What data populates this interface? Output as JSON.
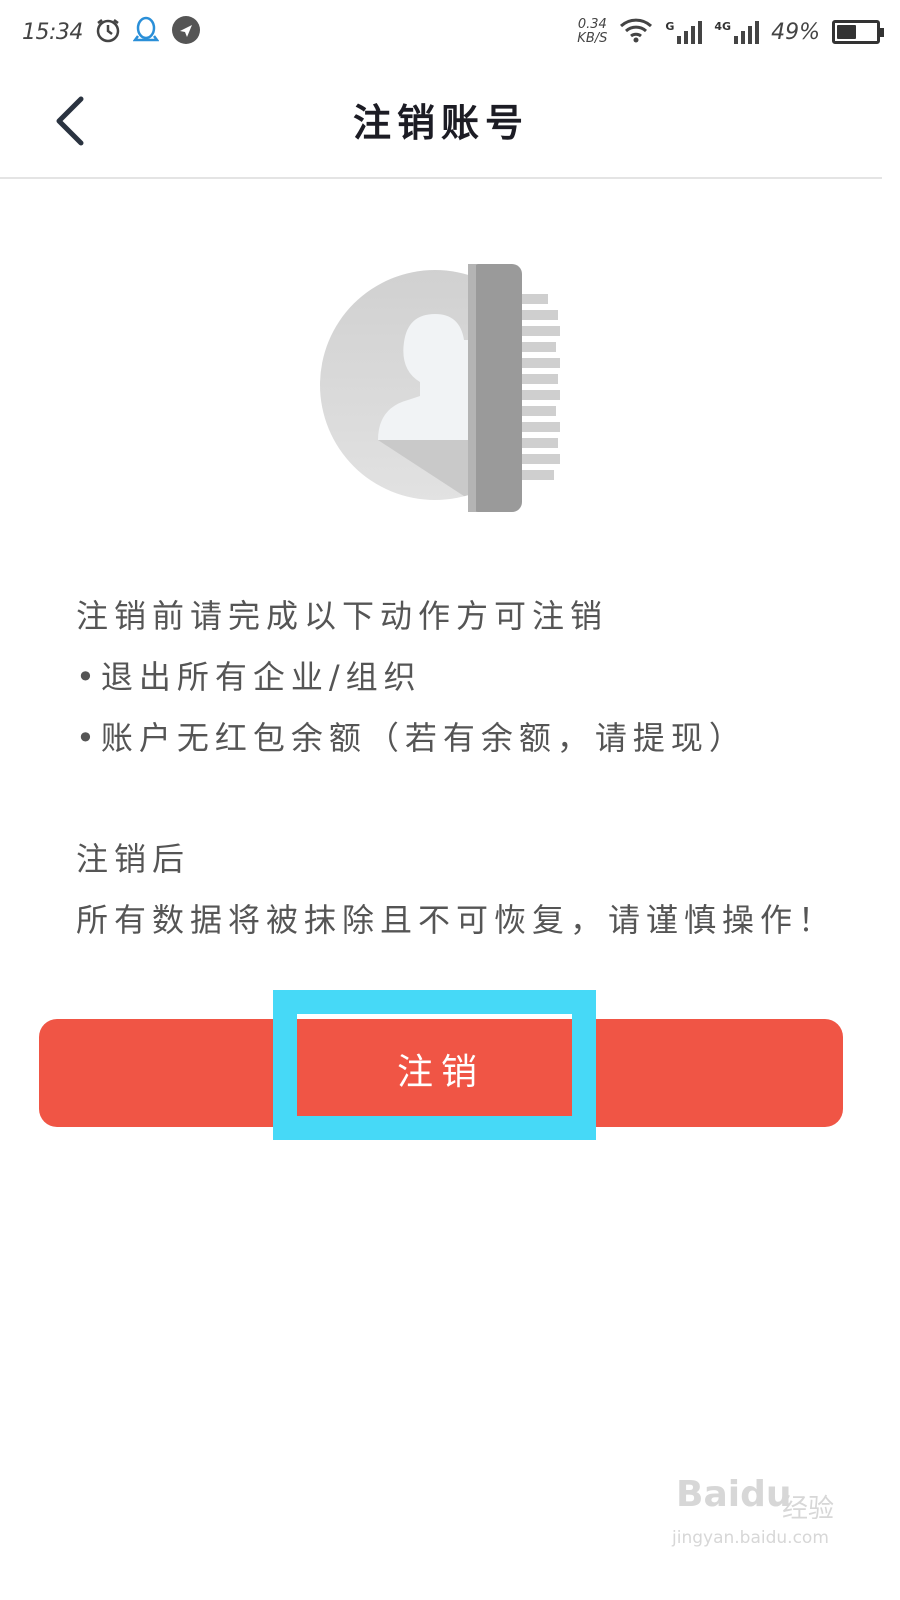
{
  "status_bar": {
    "time": "15:34",
    "speed_value": "0.34",
    "speed_unit": "KB/S",
    "signal1_label": "G",
    "signal2_label": "4G",
    "battery_text": "49%",
    "battery_level": 0.49,
    "icons": [
      "alarm-icon",
      "qq-icon",
      "location-icon",
      "wifi-icon",
      "signal-icon",
      "battery-icon"
    ]
  },
  "header": {
    "back_icon": "back-arrow-icon",
    "title": "注销账号"
  },
  "illustration": {
    "icon": "erase-account-icon"
  },
  "content": {
    "intro": "注销前请完成以下动作方可注销",
    "requirements": [
      "•退出所有企业/组织",
      "•账户无红包余额（若有余额，请提现）"
    ],
    "after_heading": "注销后",
    "warning": "所有数据将被抹除且不可恢复，请谨慎操作！"
  },
  "actions": {
    "cancel_button_label": "注销"
  },
  "watermark": {
    "brand": "Baidu",
    "text": "经验",
    "url": "jingyan.baidu.com"
  },
  "colors": {
    "button": "#f05545",
    "highlight": "#46d9f7",
    "title": "#1c1c24",
    "body_text": "#555555"
  }
}
